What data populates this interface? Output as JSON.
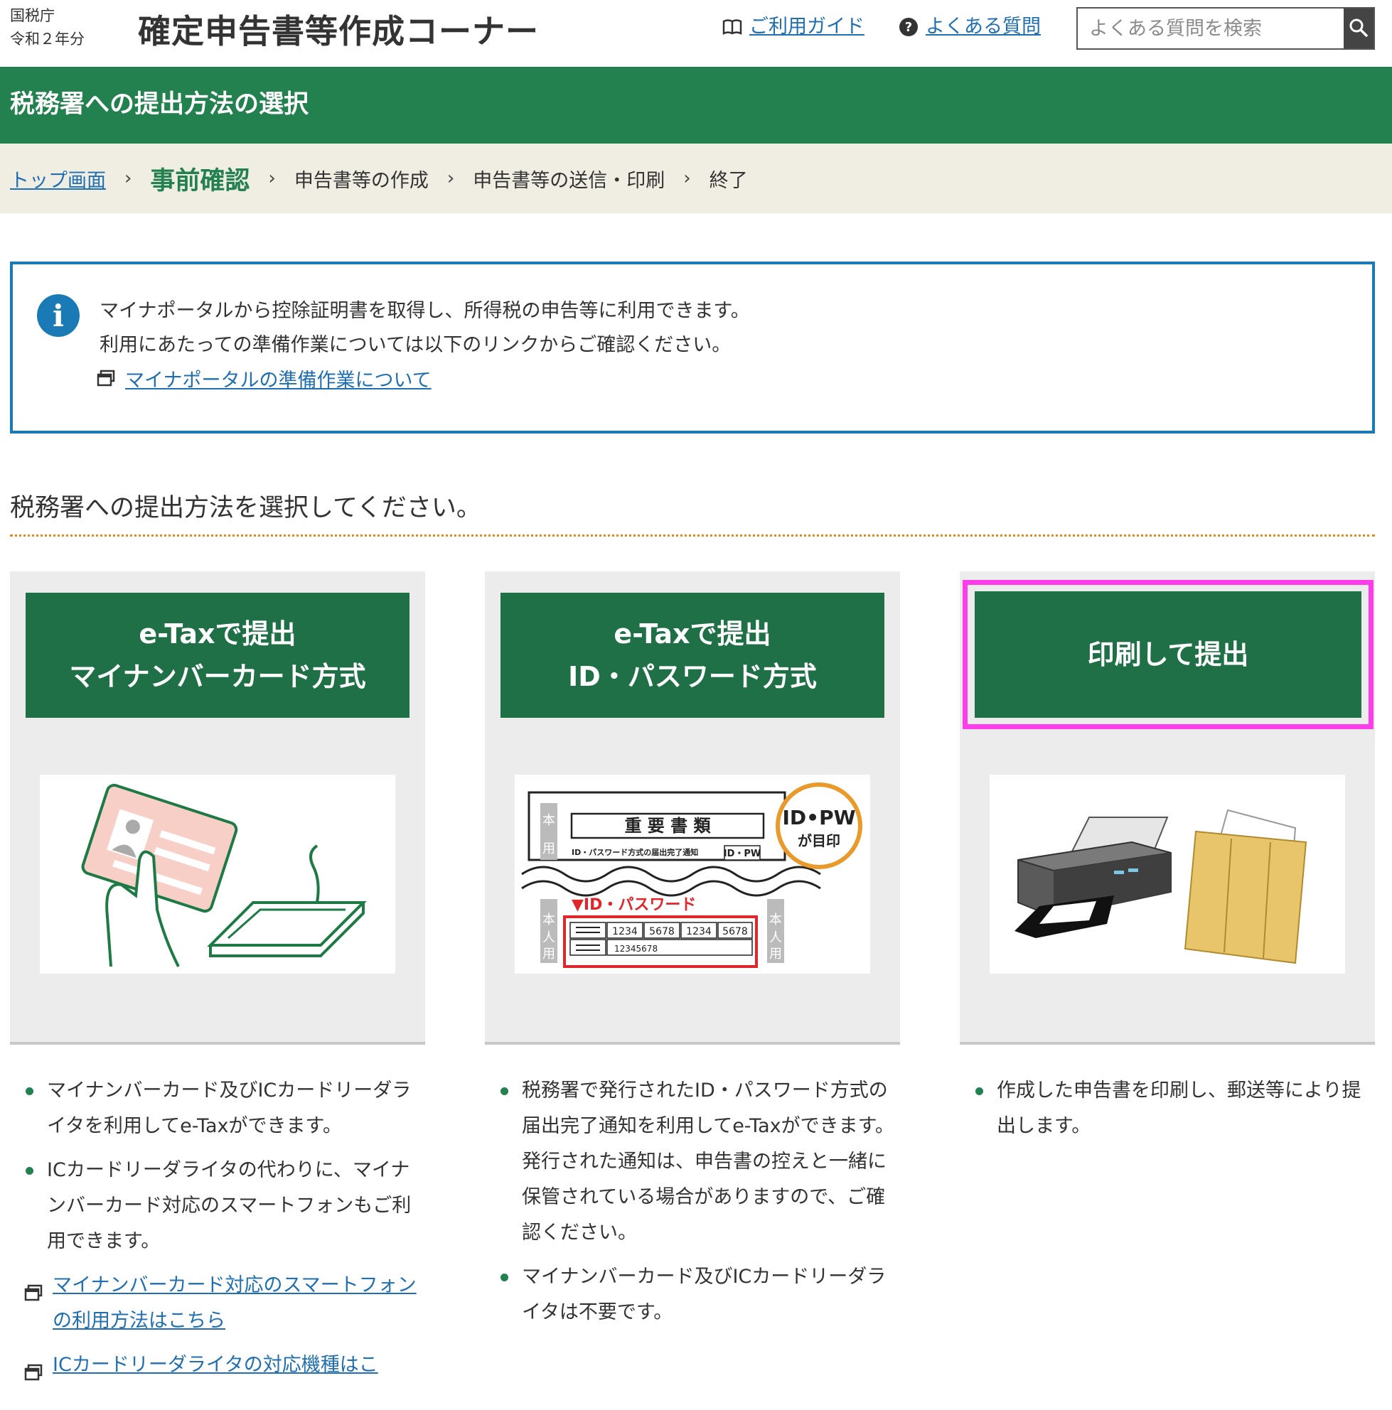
{
  "header": {
    "agency_line1": "国税庁",
    "agency_line2": "令和２年分",
    "site_title": "確定申告書等作成コーナー",
    "guide_link": "ご利用ガイド",
    "faq_link": "よくある質問",
    "search_placeholder": "よくある質問を検索"
  },
  "title_bar": {
    "page_title": "税務署への提出方法の選択"
  },
  "breadcrumb": {
    "top": "トップ画面",
    "current": "事前確認",
    "step3": "申告書等の作成",
    "step4": "申告書等の送信・印刷",
    "step5": "終了",
    "separator": "›"
  },
  "info_box": {
    "line1": "マイナポータルから控除証明書を取得し、所得税の申告等に利用できます。",
    "line2": "利用にあたっての準備作業については以下のリンクからご確認ください。",
    "link": "マイナポータルの準備作業について"
  },
  "section": {
    "heading": "税務署への提出方法を選択してください。"
  },
  "cards": [
    {
      "button_line1": "e-Taxで提出",
      "button_line2": "マイナンバーカード方式",
      "bullets": [
        "マイナンバーカード及びICカードリーダライタを利用してe-Taxができます。",
        "ICカードリーダライタの代わりに、マイナンバーカード対応のスマートフォンもご利用できます。"
      ],
      "links": [
        "マイナンバーカード対応のスマートフォンの利用方法はこちら",
        "ICカードリーダライタの対応機種はこ"
      ]
    },
    {
      "button_line1": "e-Taxで提出",
      "button_line2": "ID・パスワード方式",
      "bullets": [
        "税務署で発行されたID・パスワード方式の届出完了通知を利用してe-Taxができます。",
        "マイナンバーカード及びICカードリーダライタは不要です。"
      ],
      "bullet1_extra": "発行された通知は、申告書の控えと一緒に保管されている場合がありますので、ご確認ください。",
      "image_text": {
        "doc_title": "重 要 書 類",
        "doc_sub": "ID・パスワード方式の届出完了通知",
        "tag": "ID・PW",
        "stamp_line1": "ID•PW",
        "stamp_line2": "が目印",
        "side": "本人用",
        "red_label": "▼ID・パスワード",
        "cells": [
          "1234",
          "5678",
          "1234",
          "5678"
        ],
        "pw": "12345678"
      }
    },
    {
      "button_line1": "印刷して提出",
      "bullets": [
        "作成した申告書を印刷し、郵送等により提出します。"
      ]
    }
  ],
  "colors": {
    "brand_green": "#23804f",
    "button_green": "#1f6f47",
    "link_blue": "#1f6fb2",
    "info_blue": "#1a7ab5",
    "highlight_magenta": "#ff3dea",
    "dotted_orange": "#e38a1f"
  }
}
